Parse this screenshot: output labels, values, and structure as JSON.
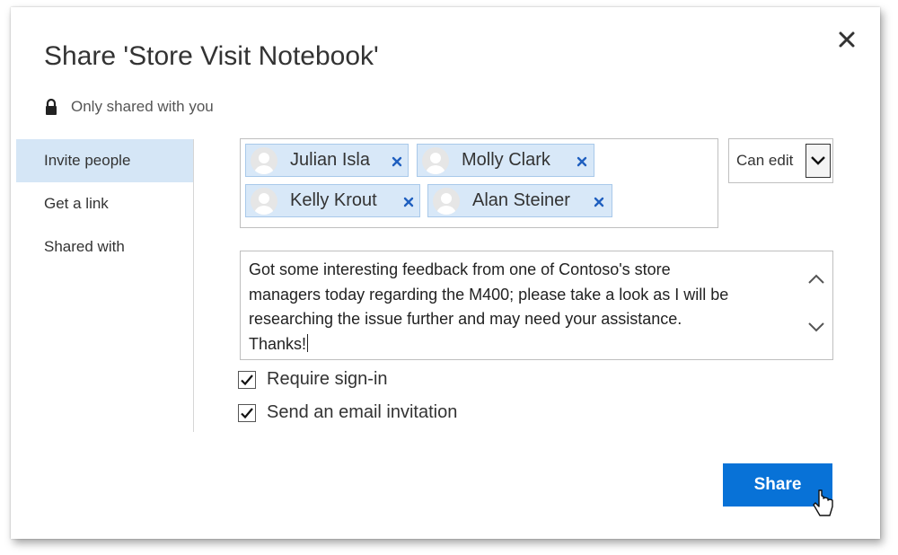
{
  "dialog": {
    "title": "Share 'Store Visit Notebook'",
    "privacy_text": "Only shared with you"
  },
  "sidebar": {
    "items": [
      {
        "label": "Invite people",
        "active": true
      },
      {
        "label": "Get a link",
        "active": false
      },
      {
        "label": "Shared with",
        "active": false
      }
    ]
  },
  "recipients": [
    {
      "name": "Julian Isla"
    },
    {
      "name": "Molly Clark"
    },
    {
      "name": "Kelly Krout"
    },
    {
      "name": "Alan Steiner"
    }
  ],
  "permission": {
    "selected": "Can edit"
  },
  "message": {
    "lines": [
      "Got some interesting feedback from one of Contoso's store",
      "managers today regarding the M400; please take a look as I will be",
      "researching the issue further and may need your assistance.",
      "Thanks!"
    ]
  },
  "options": {
    "require_signin": {
      "label": "Require sign-in",
      "checked": true
    },
    "send_email": {
      "label": "Send an email invitation",
      "checked": true
    }
  },
  "actions": {
    "share_label": "Share"
  },
  "colors": {
    "accent": "#0872d7",
    "chip_bg": "#d8e8f8",
    "chip_remove": "#1f5fbf",
    "sidebar_active": "#d5e6f6"
  }
}
